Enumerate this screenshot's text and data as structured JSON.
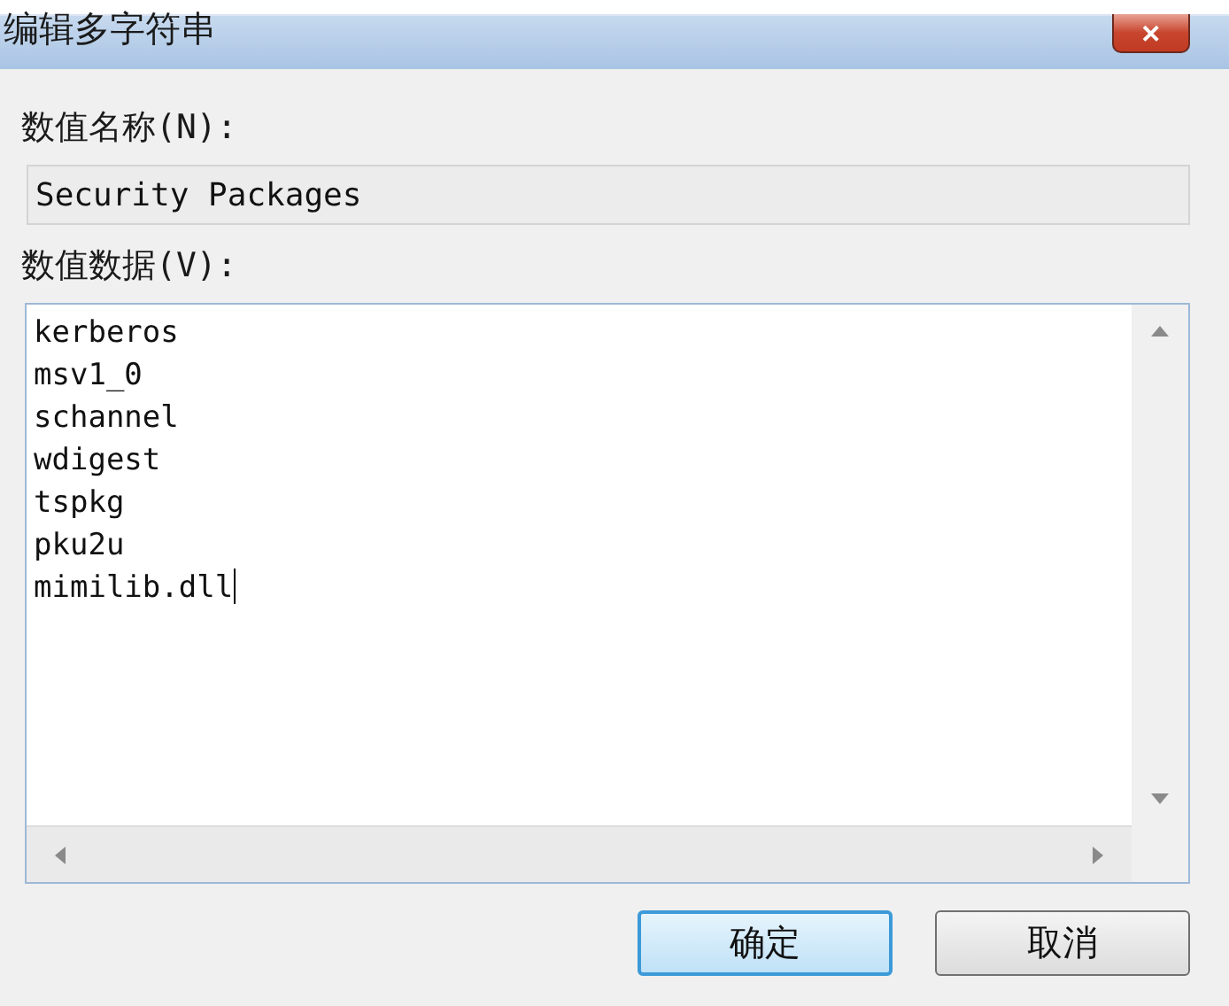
{
  "window": {
    "title": "编辑多字符串",
    "close": "✕"
  },
  "value_name": {
    "label": "数值名称(N):",
    "value": "Security Packages"
  },
  "value_data": {
    "label": "数值数据(V):",
    "caret": true,
    "lines": [
      "kerberos",
      "msv1_0",
      "schannel",
      "wdigest",
      "tspkg",
      "pku2u",
      "mimilib.dll"
    ]
  },
  "buttons": [
    {
      "label": "确定",
      "default": true
    },
    {
      "label": "取消",
      "default": false
    }
  ]
}
